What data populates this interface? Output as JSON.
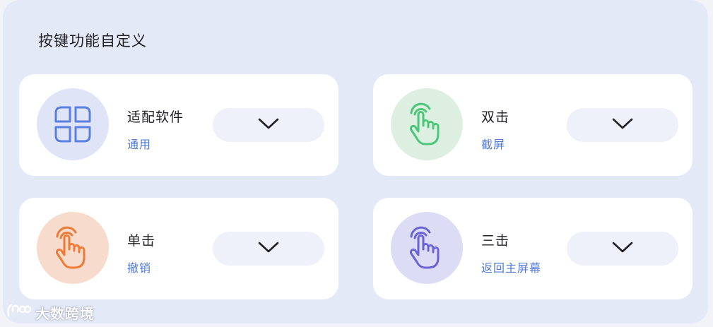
{
  "section": {
    "title": "按键功能自定义"
  },
  "cards": [
    {
      "name": "适配软件",
      "value": "通用",
      "icon": "grid-icon",
      "circle_color": "#dfe4f7",
      "icon_color": "#5b7fde"
    },
    {
      "name": "双击",
      "value": "截屏",
      "icon": "tap-hand-icon",
      "circle_color": "#dcefe1",
      "icon_color": "#4cc77a"
    },
    {
      "name": "单击",
      "value": "撤销",
      "icon": "tap-hand-icon",
      "circle_color": "#f7dccd",
      "icon_color": "#ee7a35"
    },
    {
      "name": "三击",
      "value": "返回主屏幕",
      "icon": "tap-hand-icon",
      "circle_color": "#dcdcf5",
      "icon_color": "#6a63d6"
    }
  ],
  "dropdown_icon": "chevron-down-icon",
  "watermark": {
    "text": "大数跨境"
  },
  "colors": {
    "background": "#e4e9f8",
    "card": "#ffffff",
    "value_text": "#4f7ad8",
    "dropdown_bg": "#eef0fa"
  }
}
